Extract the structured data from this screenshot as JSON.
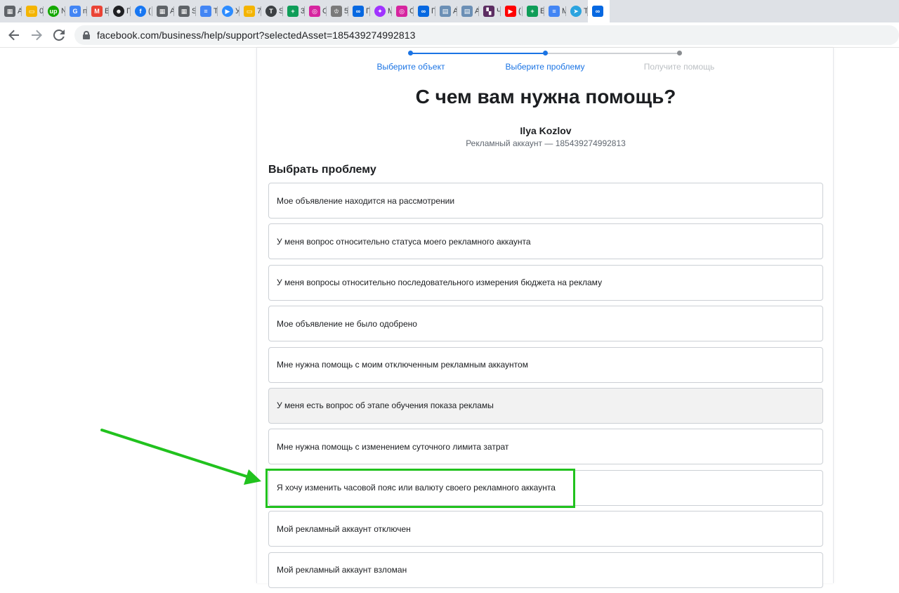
{
  "browser": {
    "tabs": [
      {
        "icon": "chart-doc-icon",
        "color": "#5f6368",
        "label": "A"
      },
      {
        "icon": "slides-icon",
        "color": "#f4b400",
        "label": "0"
      },
      {
        "icon": "upwork-icon",
        "color": "#14a800",
        "label": "N"
      },
      {
        "icon": "google-icon",
        "color": "#4285f4",
        "label": "n"
      },
      {
        "icon": "gmail-icon",
        "color": "#ea4335",
        "label": "B"
      },
      {
        "icon": "alien-icon",
        "color": "#202124",
        "label": "Г"
      },
      {
        "icon": "facebook-icon",
        "color": "#1877f2",
        "label": "("
      },
      {
        "icon": "chart-doc-icon",
        "color": "#5f6368",
        "label": "A"
      },
      {
        "icon": "chart-doc-icon",
        "color": "#5f6368",
        "label": "S"
      },
      {
        "icon": "docs-icon",
        "color": "#4285f4",
        "label": "T"
      },
      {
        "icon": "zoom-icon",
        "color": "#2d8cff",
        "label": "У"
      },
      {
        "icon": "slides-icon",
        "color": "#f4b400",
        "label": "7"
      },
      {
        "icon": "t-circle-icon",
        "color": "#3c4043",
        "label": "S"
      },
      {
        "icon": "sheets-icon",
        "color": "#0f9d58",
        "label": "3"
      },
      {
        "icon": "instagram-icon",
        "color": "#d6249f",
        "label": "C"
      },
      {
        "icon": "crown-icon",
        "color": "#7a7a7a",
        "label": "5"
      },
      {
        "icon": "meta-icon",
        "color": "#0668e1",
        "label": "П"
      },
      {
        "icon": "messenger-icon",
        "color": "#a033ff",
        "label": "M"
      },
      {
        "icon": "instagram-icon",
        "color": "#d6249f",
        "label": "C"
      },
      {
        "icon": "meta-icon",
        "color": "#0668e1",
        "label": "П"
      },
      {
        "icon": "notebook-icon",
        "color": "#6b8fb5",
        "label": "A"
      },
      {
        "icon": "notebook-icon",
        "color": "#6b8fb5",
        "label": "A"
      },
      {
        "icon": "film-icon",
        "color": "#5c2d62",
        "label": "Ч"
      },
      {
        "icon": "youtube-icon",
        "color": "#ff0000",
        "label": "("
      },
      {
        "icon": "sheets-icon",
        "color": "#0f9d58",
        "label": "E"
      },
      {
        "icon": "docs-icon",
        "color": "#4285f4",
        "label": "M"
      },
      {
        "icon": "telegram-icon",
        "color": "#2aa3df",
        "label": "Te"
      },
      {
        "icon": "meta-icon",
        "color": "#0668e1",
        "label": ""
      }
    ],
    "url": "facebook.com/business/help/support?selectedAsset=185439274992813"
  },
  "stepper": {
    "steps": [
      "Выберите объект",
      "Выберите проблему",
      "Получите помощь"
    ]
  },
  "page": {
    "title": "С чем вам нужна помощь?",
    "account_name": "Ilya Kozlov",
    "account_id": "Рекламный аккаунт — 185439274992813",
    "section_title": "Выбрать проблему",
    "options": [
      "Мое объявление находится на рассмотрении",
      "У меня вопрос относительно статуса моего рекламного аккаунта",
      "У меня вопросы относительно последовательного измерения бюджета на рекламу",
      "Мое объявление не было одобрено",
      "Мне нужна помощь с моим отключенным рекламным аккаунтом",
      "У меня есть вопрос об этапе обучения показа рекламы",
      "Мне нужна помощь с изменением суточного лимита затрат",
      "Я хочу изменить часовой пояс или валюту своего рекламного аккаунта",
      "Мой рекламный аккаунт отключен",
      "Мой рекламный аккаунт взломан"
    ]
  },
  "colors": {
    "accent": "#1b74e4",
    "annotation": "#21c21e"
  }
}
